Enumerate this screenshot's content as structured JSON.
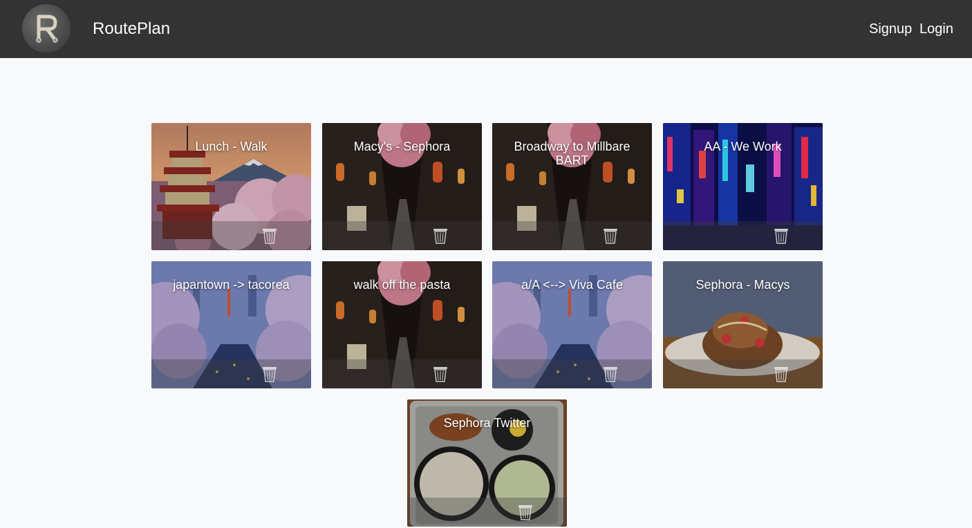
{
  "app": {
    "brand": "RoutePlan"
  },
  "nav": {
    "signup_label": "Signup",
    "login_label": "Login"
  },
  "routes": [
    {
      "title": "Lunch - Walk",
      "image": "pagoda-fuji-cherry-blossoms"
    },
    {
      "title": "Macy's - Sephora",
      "image": "lantern-alley"
    },
    {
      "title": "Broadway to Millbare BART",
      "image": "lantern-alley"
    },
    {
      "title": "AA - We Work",
      "image": "neon-city-street"
    },
    {
      "title": "japantown -> tacorea",
      "image": "cherry-blossom-river"
    },
    {
      "title": "walk off the pasta",
      "image": "lantern-alley"
    },
    {
      "title": "a/A <--> Viva Cafe",
      "image": "cherry-blossom-river"
    },
    {
      "title": "Sephora - Macys",
      "image": "french-toast-plate"
    },
    {
      "title": "Sephora Twitter",
      "image": "bento-tray"
    }
  ],
  "icons": {
    "logo": "routeplan-r-logo",
    "delete": "trash-icon"
  },
  "colors": {
    "navbar": "#333333",
    "page_background": "#f8f9fb",
    "text_light": "#ffffff"
  }
}
